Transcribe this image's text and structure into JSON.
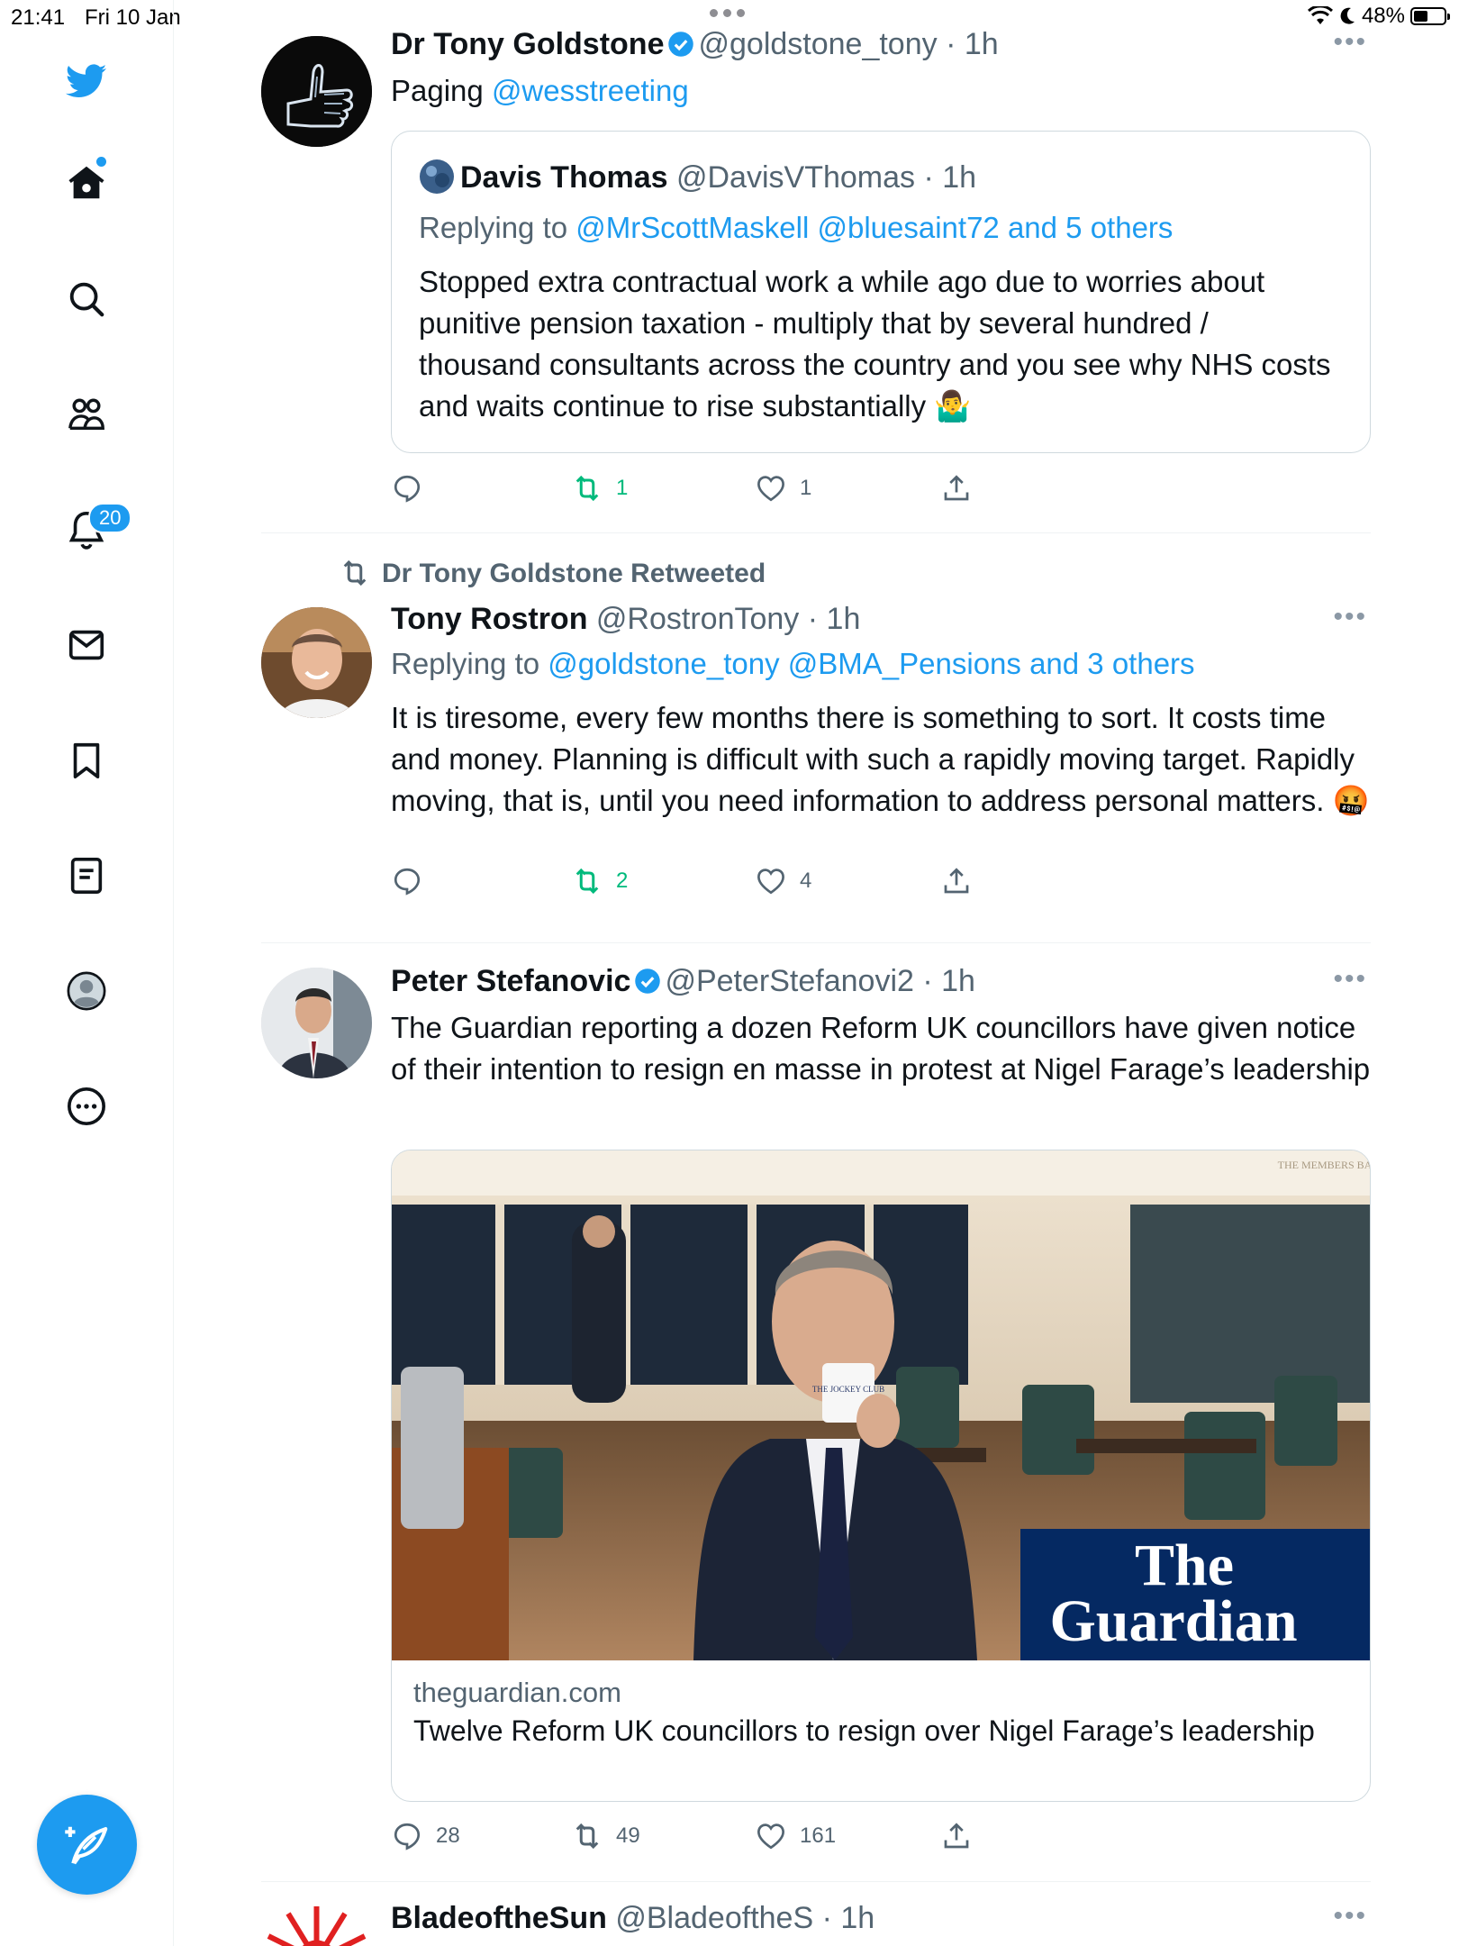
{
  "status_bar": {
    "time": "21:41",
    "date": "Fri 10 Jan",
    "battery": "48%",
    "battery_level": 0.48
  },
  "sidebar": {
    "notifications_badge": "20"
  },
  "tweets": [
    {
      "name": "Dr Tony Goldstone",
      "handle": "@goldstone_tony",
      "time": "· 1h",
      "verified": true,
      "text_prefix": "Paging ",
      "text_mention": "@wesstreeting",
      "quote": {
        "name": "Davis Thomas",
        "handle": "@DavisVThomas",
        "time": "· 1h",
        "replying_to_label": "Replying to ",
        "replying_to_links": "@MrScottMaskell @bluesaint72 and 5 others",
        "text": "Stopped extra contractual work a while ago due to worries about punitive pension taxation - multiply that by several hundred / thousand consultants across the country and you see why NHS costs and waits continue to rise substantially 🤷‍♂️"
      },
      "replies": "",
      "retweets": "1",
      "likes": "1"
    },
    {
      "retweeted_by": "Dr Tony Goldstone Retweeted",
      "name": "Tony Rostron",
      "handle": "@RostronTony",
      "time": "· 1h",
      "verified": false,
      "replying_to_label": "Replying to ",
      "replying_to_links": "@goldstone_tony @BMA_Pensions and 3 others",
      "text": "It is tiresome, every few months there is something to sort. It costs time and money. Planning is difficult with such a rapidly moving target. Rapidly moving, that is, until you need information to address personal matters. 🤬",
      "replies": "",
      "retweets": "2",
      "likes": "4"
    },
    {
      "name": "Peter Stefanovic",
      "handle": "@PeterStefanovi2",
      "time": "· 1h",
      "verified": true,
      "text": "The Guardian reporting a dozen Reform UK councillors have given notice of their intention to resign en masse in protest at Nigel Farage’s leadership",
      "card": {
        "domain": "theguardian.com",
        "title": "Twelve Reform UK councillors to resign over Nigel Farage’s leadership",
        "logo_line1": "The",
        "logo_line2": "Guardian",
        "mug_text": "THE JOCKEY CLUB",
        "sign_text": "THE MEMBERS BAR"
      },
      "replies": "28",
      "retweets": "49",
      "likes": "161"
    },
    {
      "name": "BladeoftheSun",
      "handle": "@BladeoftheS",
      "time": "· 1h"
    }
  ],
  "colors": {
    "accent": "#1d9bf0",
    "retweet": "#00ba7c",
    "secondary": "#536471",
    "guardian": "#052962"
  }
}
